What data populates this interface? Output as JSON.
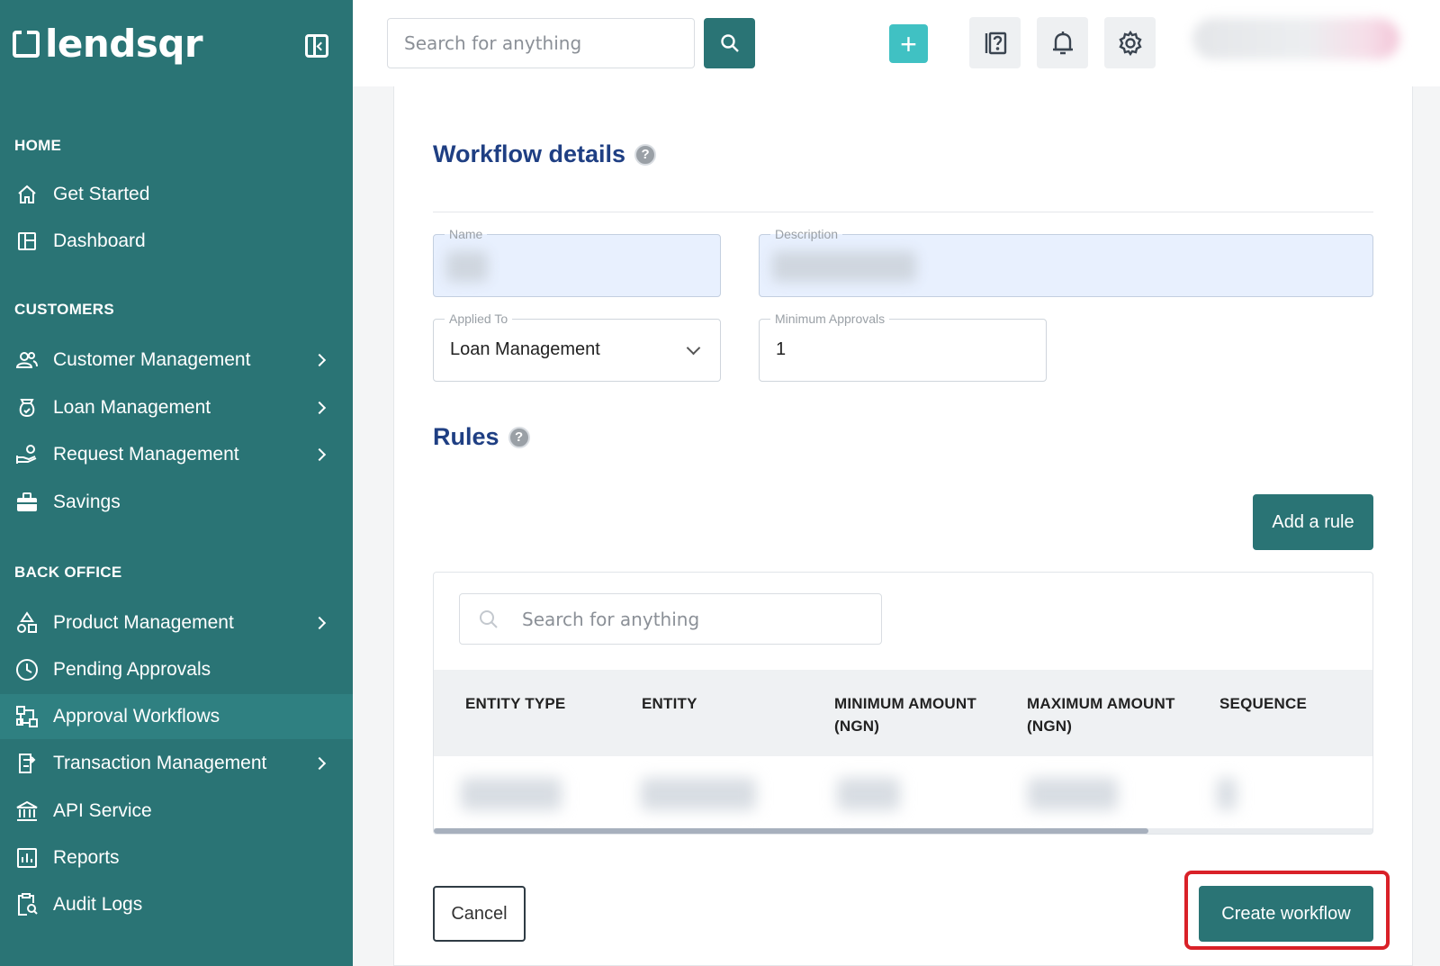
{
  "brand": {
    "name": "lendsqr"
  },
  "sidebar": {
    "sections": {
      "home": "HOME",
      "customers": "CUSTOMERS",
      "back_office": "BACK OFFICE"
    },
    "items": {
      "get_started": "Get Started",
      "dashboard": "Dashboard",
      "customer_management": "Customer Management",
      "loan_management": "Loan Management",
      "request_management": "Request Management",
      "savings": "Savings",
      "product_management": "Product Management",
      "pending_approvals": "Pending Approvals",
      "approval_workflows": "Approval Workflows",
      "transaction_management": "Transaction Management",
      "api_service": "API Service",
      "reports": "Reports",
      "audit_logs": "Audit Logs"
    },
    "active_item": "approval_workflows"
  },
  "topbar": {
    "search_placeholder": "Search for anything",
    "plus_label": "+"
  },
  "workflow": {
    "title": "Workflow details",
    "help": "?",
    "name_label": "Name",
    "description_label": "Description",
    "applied_to_label": "Applied To",
    "applied_to_value": "Loan Management",
    "min_approvals_label": "Minimum Approvals",
    "min_approvals_value": "1"
  },
  "rules": {
    "title": "Rules",
    "help": "?",
    "add_rule": "Add a rule",
    "search_placeholder": "Search for anything",
    "columns": {
      "entity_type": "ENTITY TYPE",
      "entity": "ENTITY",
      "min_amount": "MINIMUM AMOUNT",
      "min_amount_unit": "(NGN)",
      "max_amount": "MAXIMUM AMOUNT",
      "max_amount_unit": "(NGN)",
      "sequence": "SEQUENCE"
    }
  },
  "actions": {
    "cancel": "Cancel",
    "create": "Create workflow"
  },
  "colors": {
    "sidebar": "#2a7475",
    "primary": "#2a7475",
    "accent": "#40c1c3",
    "heading": "#1f3f83",
    "highlight": "#d92128"
  }
}
